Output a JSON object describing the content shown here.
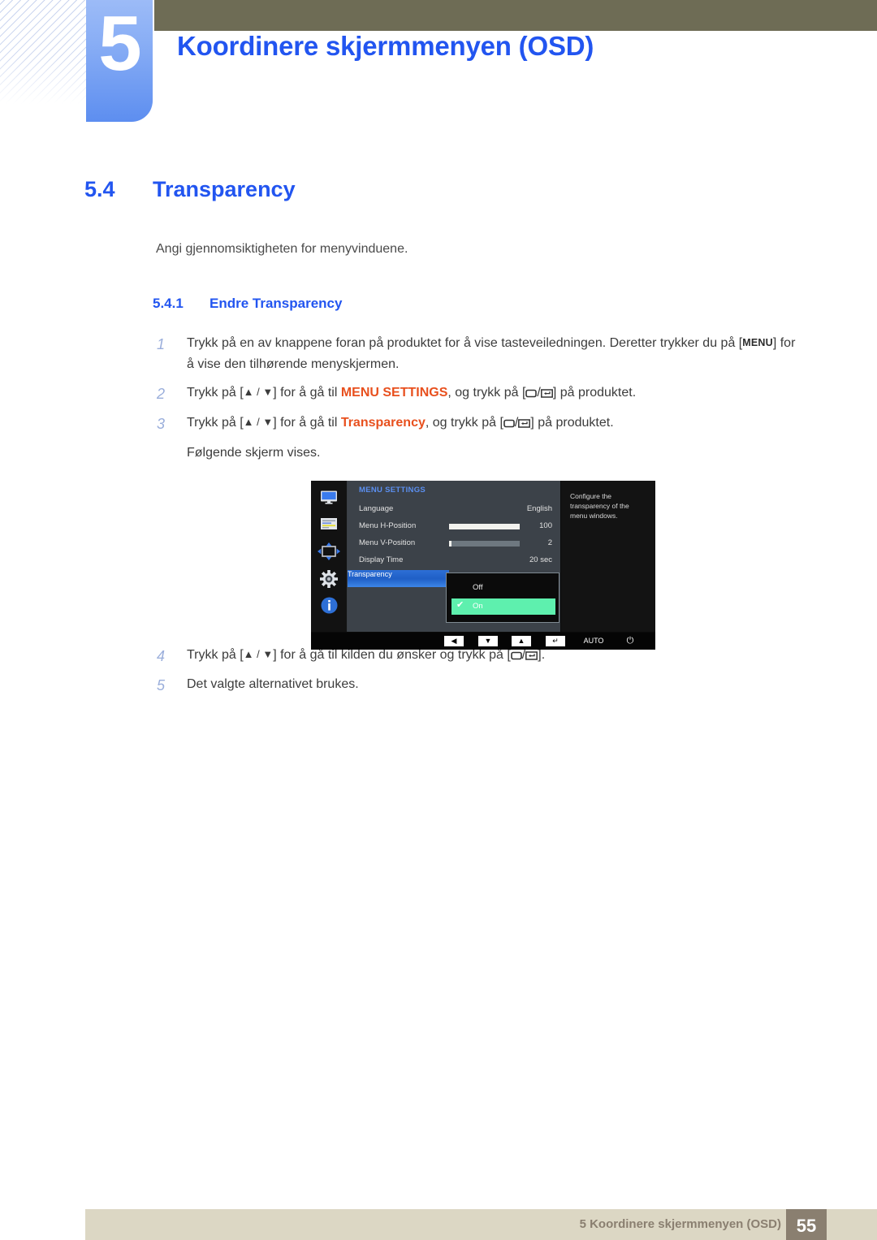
{
  "header": {
    "chapter_number": "5",
    "chapter_title": "Koordinere skjermmenyen (OSD)"
  },
  "section": {
    "number": "5.4",
    "title": "Transparency",
    "description": "Angi gjennomsiktigheten for menyvinduene.",
    "sub_number": "5.4.1",
    "sub_title": "Endre Transparency"
  },
  "steps": [
    {
      "n": "1",
      "p1": "Trykk på en av knappene foran på produktet for å vise tasteveiledningen. Deretter trykker du på [",
      "key": "MENU",
      "p2": "] for å vise den tilhørende menyskjermen."
    },
    {
      "n": "2",
      "p1": "Trykk på [",
      "arrows": "▲ / ▼",
      "p2": "] for å gå til ",
      "highlight": "MENU SETTINGS",
      "p3": ", og trykk på [",
      "p4": "] på produktet."
    },
    {
      "n": "3",
      "p1": "Trykk på [",
      "arrows": "▲ / ▼",
      "p2": "] for å gå til ",
      "highlight": "Transparency",
      "p3": ", og trykk på [",
      "p4": "] på produktet.",
      "sub": "Følgende skjerm vises."
    },
    {
      "n": "4",
      "p1": "Trykk på [",
      "arrows": "▲ / ▼",
      "p2": "] for å gå til kilden du ønsker og trykk på [",
      "p4": "]."
    },
    {
      "n": "5",
      "p1": "Det valgte alternativet brukes."
    }
  ],
  "osd": {
    "menu_title": "MENU SETTINGS",
    "sidebar_icons": [
      "monitor-icon",
      "picture-list-icon",
      "position-arrows-icon",
      "gear-icon",
      "info-icon"
    ],
    "rows": [
      {
        "label": "Language",
        "value": "English",
        "bar": null
      },
      {
        "label": "Menu H-Position",
        "value": "100",
        "bar": 100
      },
      {
        "label": "Menu V-Position",
        "value": "2",
        "bar": 2
      },
      {
        "label": "Display Time",
        "value": "20 sec",
        "bar": null
      },
      {
        "label": "Transparency",
        "value": "",
        "bar": null,
        "selected": true
      }
    ],
    "popup": {
      "options": [
        {
          "label": "Off",
          "checked": false
        },
        {
          "label": "On",
          "checked": true
        }
      ],
      "check_glyph": "✔"
    },
    "help_text": "Configure the transparency of the menu windows.",
    "footer_keys": [
      {
        "name": "left-key",
        "glyph": "◀"
      },
      {
        "name": "down-key",
        "glyph": "▼"
      },
      {
        "name": "up-key",
        "glyph": "▲"
      },
      {
        "name": "enter-key",
        "glyph": "↵"
      },
      {
        "name": "auto-key",
        "glyph": "AUTO"
      },
      {
        "name": "power-key",
        "glyph": "⏻"
      }
    ],
    "colors": {
      "selected_blue": "#2d6fd6",
      "option_green": "#5ef0ae",
      "title_blue": "#5b8ff0",
      "panel_gray": "#3c4249"
    }
  },
  "footer": {
    "text": "5 Koordinere skjermmenyen (OSD)",
    "page": "55"
  },
  "theme": {
    "heading_blue": "#2255f0",
    "highlight_orange": "#e8501e",
    "olive": "#6e6c55",
    "footer_beige": "#dcd7c4",
    "footer_brown": "#8a7f70"
  }
}
